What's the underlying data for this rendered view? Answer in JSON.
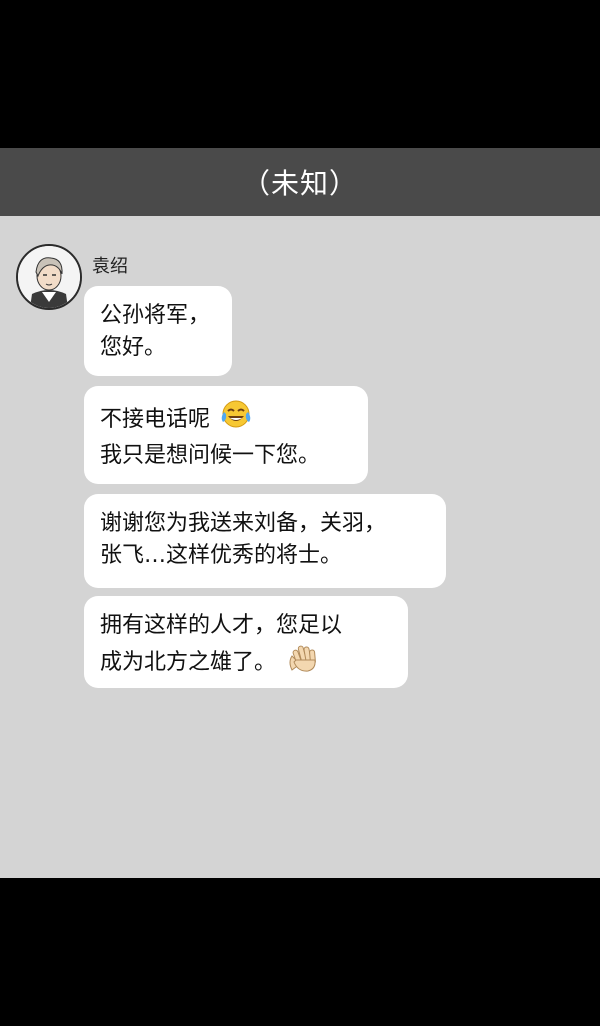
{
  "header": {
    "title": "（未知）"
  },
  "colors": {
    "title_bar": "#4a4a4a",
    "chat_background": "#d4d4d4",
    "bubble": "#ffffff",
    "frame": "#000000"
  },
  "sender": {
    "name": "袁绍",
    "avatar_icon": "portrait-avatar-icon"
  },
  "messages": [
    {
      "lines": [
        "公孙将军，",
        "您好。"
      ]
    },
    {
      "lines": [
        "不接电话呢",
        "我只是想问候一下您。"
      ],
      "emoji": "tears-of-joy-emoji"
    },
    {
      "lines": [
        "谢谢您为我送来刘备，关羽，",
        "张飞…这样优秀的将士。"
      ]
    },
    {
      "lines": [
        "拥有这样的人才，您足以",
        "成为北方之雄了。"
      ],
      "emoji": "waving-hand-emoji"
    }
  ]
}
